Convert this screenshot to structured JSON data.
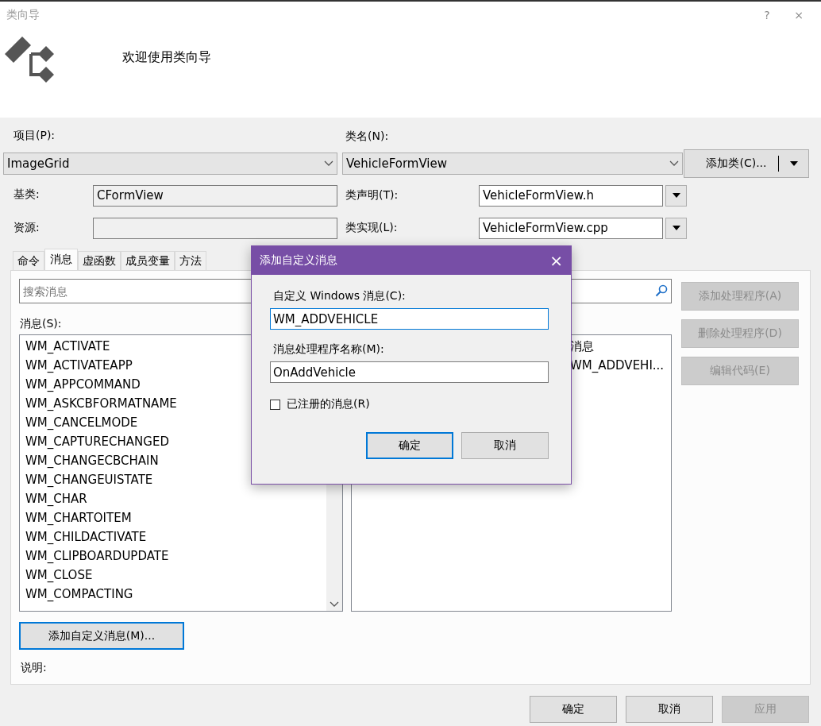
{
  "window": {
    "title": "类向导",
    "help": "?",
    "close": "×"
  },
  "header": {
    "welcome": "欢迎使用类向导"
  },
  "project": {
    "label": "项目(P):",
    "value": "ImageGrid"
  },
  "class_name": {
    "label": "类名(N):",
    "value": "VehicleFormView"
  },
  "add_class_button": {
    "label": "添加类(C)..."
  },
  "base_class": {
    "label": "基类:",
    "value": "CFormView"
  },
  "resource": {
    "label": "资源:"
  },
  "class_declaration": {
    "label": "类声明(T):",
    "value": "VehicleFormView.h"
  },
  "class_implementation": {
    "label": "类实现(L):",
    "value": "VehicleFormView.cpp"
  },
  "tabs": [
    {
      "label": "命令",
      "selected": false
    },
    {
      "label": "消息",
      "selected": true
    },
    {
      "label": "虚函数",
      "selected": false
    },
    {
      "label": "成员变量",
      "selected": false
    },
    {
      "label": "方法",
      "selected": false
    }
  ],
  "search": {
    "placeholder": "搜索消息"
  },
  "messages": {
    "label": "消息(S):",
    "items": [
      "WM_ACTIVATE",
      "WM_ACTIVATEAPP",
      "WM_APPCOMMAND",
      "WM_ASKCBFORMATNAME",
      "WM_CANCELMODE",
      "WM_CAPTURECHANGED",
      "WM_CHANGECBCHAIN",
      "WM_CHANGEUISTATE",
      "WM_CHAR",
      "WM_CHARTOITEM",
      "WM_CHILDACTIVATE",
      "WM_CLIPBOARDUPDATE",
      "WM_CLOSE",
      "WM_COMPACTING"
    ]
  },
  "handlers": {
    "column_header": "消息",
    "rows": [
      "WM_ADDVEHI..."
    ]
  },
  "side_buttons": [
    {
      "label": "添加处理程序(A)",
      "disabled": true
    },
    {
      "label": "删除处理程序(D)",
      "disabled": true
    },
    {
      "label": "编辑代码(E)",
      "disabled": true
    }
  ],
  "add_custom_message_button": {
    "label": "添加自定义消息(M)...",
    "focused": true
  },
  "description": {
    "label": "说明:"
  },
  "footer_buttons": [
    {
      "label": "确定",
      "disabled": false
    },
    {
      "label": "取消",
      "disabled": false
    },
    {
      "label": "应用",
      "disabled": true
    }
  ],
  "dialog": {
    "title": "添加自定义消息",
    "close": "×",
    "message_label": "自定义 Windows 消息(C):",
    "message_value": "WM_ADDVEHICLE",
    "handler_label": "消息处理程序名称(M):",
    "handler_value": "OnAddVehicle",
    "registered": {
      "label": "已注册的消息(R)",
      "checked": false
    },
    "buttons": [
      {
        "label": "确定",
        "default": true
      },
      {
        "label": "取消",
        "default": false
      }
    ]
  }
}
